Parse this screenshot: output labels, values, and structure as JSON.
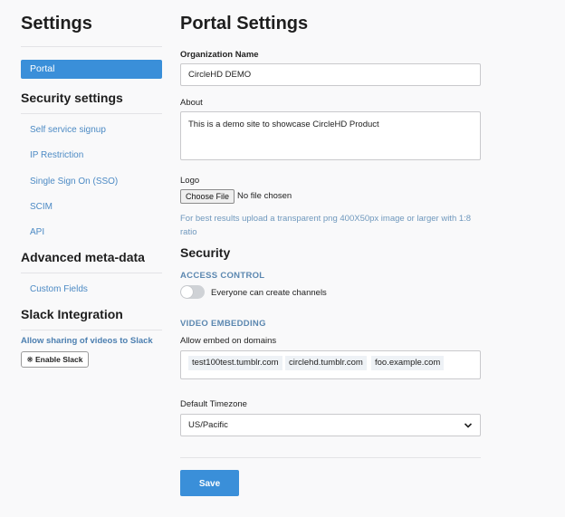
{
  "sidebar": {
    "title": "Settings",
    "portal_label": "Portal",
    "security_heading": "Security settings",
    "security_links": [
      "Self service signup",
      "IP Restriction",
      "Single Sign On (SSO)",
      "SCIM",
      "API"
    ],
    "meta_heading": "Advanced meta-data",
    "meta_links": [
      "Custom Fields"
    ],
    "slack_heading": "Slack Integration",
    "slack_label": "Allow sharing of videos to Slack",
    "slack_button": "Enable Slack"
  },
  "main": {
    "title": "Portal Settings",
    "org_label": "Organization Name",
    "org_value": "CircleHD DEMO",
    "about_label": "About",
    "about_value": "This is a demo site to showcase CircleHD Product",
    "logo_label": "Logo",
    "file_button": "Choose File",
    "file_status": "No file chosen",
    "logo_hint": "For best results upload a transparent png 400X50px image or larger with 1:8 ratio",
    "security_title": "Security",
    "access_control_label": "ACCESS CONTROL",
    "channels_toggle_label": "Everyone can create channels",
    "channels_toggle_on": false,
    "video_embedding_label": "VIDEO EMBEDDING",
    "embed_domains_label": "Allow embed on domains",
    "embed_domains": [
      "test100test.tumblr.com",
      "circlehd.tumblr.com",
      "foo.example.com"
    ],
    "timezone_label": "Default Timezone",
    "timezone_value": "US/Pacific",
    "save_button": "Save"
  },
  "colors": {
    "accent": "#3a8fd9",
    "link": "#4c8ac4",
    "hint": "#6f98bd"
  }
}
